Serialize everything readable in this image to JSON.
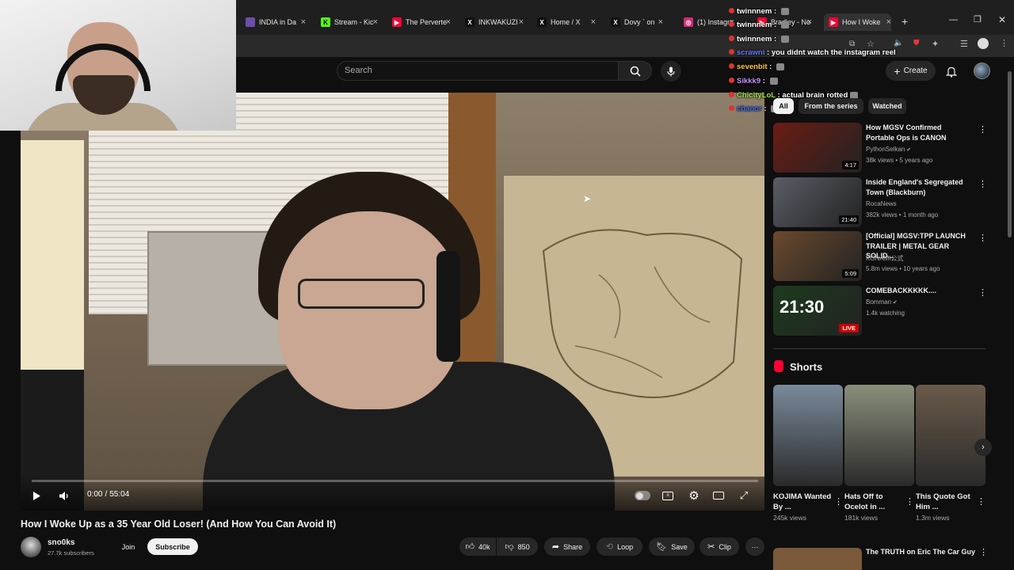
{
  "browser": {
    "tabs": [
      {
        "label": "INDIA in Da",
        "favicon": "stripes"
      },
      {
        "label": "Stream - Kic",
        "favicon": "kick"
      },
      {
        "label": "The Perverte",
        "favicon": "youtube"
      },
      {
        "label": "INKWAKUZI",
        "favicon": "x"
      },
      {
        "label": "Home / X",
        "favicon": "x"
      },
      {
        "label": "Dovy ` on",
        "favicon": "x"
      },
      {
        "label": "(1) Instagra",
        "favicon": "instagram"
      },
      {
        "label": "Bradley - No",
        "favicon": "youtube"
      },
      {
        "label": "How I Woke",
        "favicon": "youtube"
      }
    ],
    "new_tab": "+"
  },
  "youtube": {
    "search_placeholder": "Search",
    "create_label": "Create"
  },
  "video": {
    "time_current": "0:00",
    "time_sep": "/",
    "time_total": "55:04",
    "progress": 0.0,
    "title": "How I Woke Up as a 35 Year Old Loser! (And How You Can Avoid It)",
    "channel": "sno0ks",
    "subscribers": "27.7k subscribers",
    "join_label": "Join",
    "subscribe_label": "Subscribe",
    "likes": "40k",
    "dislikes": "850",
    "share_label": "Share",
    "loop_label": "Loop",
    "save_label": "Save",
    "clip_label": "Clip",
    "more_label": "···"
  },
  "chat": [
    {
      "user": "twinnnem",
      "user_color": "#ffffff",
      "message": "",
      "emote": true
    },
    {
      "user": "twinnnem",
      "user_color": "#ffffff",
      "message": "",
      "emote": true
    },
    {
      "user": "twinnnem",
      "user_color": "#ffffff",
      "message": "",
      "emote": true
    },
    {
      "user": "scrawni",
      "user_color": "#6a7cff",
      "message": "you didnt watch the instagram reel",
      "emote": false
    },
    {
      "user": "sevenbit",
      "user_color": "#ffc83a",
      "message": "",
      "emote": true
    },
    {
      "user": "Sikkk9",
      "user_color": "#c792ff",
      "message": "",
      "emote": true
    },
    {
      "user": "ChicityLoL",
      "user_color": "#9de04a",
      "message": "actual brain rotted",
      "emote": true
    },
    {
      "user": "chanor",
      "user_color": "#3b6cff",
      "message": "",
      "emote": true
    }
  ],
  "chips": [
    "All",
    "From the series",
    "Watched"
  ],
  "recommendations": [
    {
      "title": "How MGSV Confirmed Portable Ops is CANON",
      "channel": "PythonSelkan",
      "verified": true,
      "meta": "38k views • 5 years ago",
      "duration": "4:17",
      "live": false,
      "thumb_color": "#6b1c14"
    },
    {
      "title": "Inside England's Segregated Town (Blackburn)",
      "channel": "RocaNews",
      "verified": false,
      "meta": "382k views • 1 month ago",
      "duration": "21:40",
      "live": false,
      "thumb_color": "#5a5d66"
    },
    {
      "title": "[Official] MGSV:TPP LAUNCH TRAILER | METAL GEAR SOLID...",
      "channel": "KONAMI公式",
      "verified": false,
      "meta": "5.8m views • 10 years ago",
      "duration": "5:09",
      "live": false,
      "thumb_color": "#6b4a2e"
    },
    {
      "title": "COMEBACKKKKK....",
      "channel": "Bomman",
      "verified": true,
      "meta": "1.4k watching",
      "duration": "",
      "live": true,
      "live_label": "LIVE",
      "thumb_color": "#1d3a1d",
      "thumb_text": "21:30"
    }
  ],
  "shorts": {
    "heading": "Shorts",
    "items": [
      {
        "title": "KOJIMA Wanted By ...",
        "views": "245k views",
        "thumb_color": "#7a8a9a"
      },
      {
        "title": "Hats Off to Ocelot in ...",
        "views": "181k views",
        "thumb_color": "#8a8f7a"
      },
      {
        "title": "This Quote Got Him ...",
        "views": "1.3m views",
        "thumb_color": "#6a5a4a"
      }
    ]
  },
  "partial_rec": {
    "title": "The TRUTH on Eric The Car Guy"
  }
}
